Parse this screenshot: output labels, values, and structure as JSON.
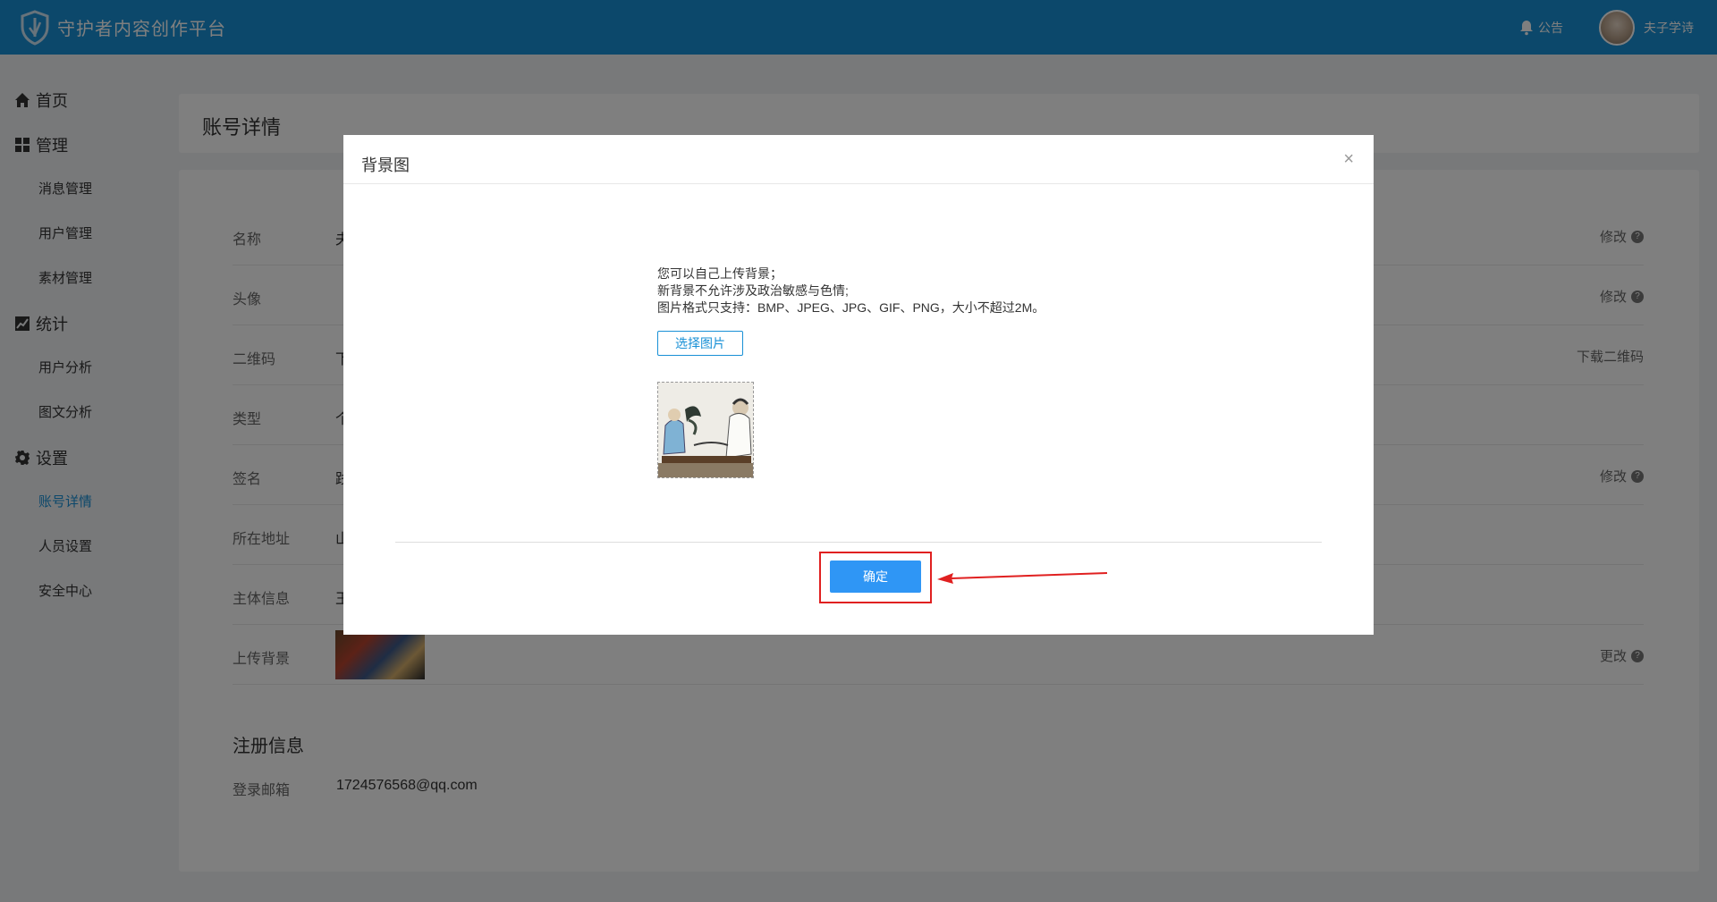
{
  "header": {
    "app_title": "守护者内容创作平台",
    "notice_label": "公告",
    "username": "夫子学诗",
    "brand_color": "#1890d6"
  },
  "sidebar": {
    "groups": [
      {
        "icon": "home-icon",
        "label": "首页"
      },
      {
        "icon": "grid-icon",
        "label": "管理"
      },
      {
        "icon": "chart-icon",
        "label": "统计"
      },
      {
        "icon": "gear-icon",
        "label": "设置"
      }
    ],
    "items": [
      "消息管理",
      "用户管理",
      "素材管理",
      "用户分析",
      "图文分析",
      "账号详情",
      "人员设置",
      "安全中心"
    ],
    "active_item": "账号详情"
  },
  "page": {
    "title": "账号详情"
  },
  "details": {
    "rows": [
      {
        "label": "名称",
        "value": "夫",
        "action": "修改"
      },
      {
        "label": "头像",
        "value": "",
        "action": "修改"
      },
      {
        "label": "二维码",
        "value": "下",
        "action": "下载二维码"
      },
      {
        "label": "类型",
        "value": "个",
        "action": ""
      },
      {
        "label": "签名",
        "value": "践",
        "action": "修改"
      },
      {
        "label": "所在地址",
        "value": "山",
        "action": ""
      },
      {
        "label": "主体信息",
        "value": "王",
        "action": ""
      },
      {
        "label": "上传背景",
        "value": "",
        "action": "更改"
      }
    ],
    "registration": {
      "title": "注册信息",
      "email_label": "登录邮箱",
      "email_value": "1724576568@qq.com"
    }
  },
  "modal": {
    "title": "背景图",
    "close_glyph": "×",
    "tips": [
      "您可以自己上传背景；",
      "新背景不允许涉及政治敏感与色情;",
      "图片格式只支持：BMP、JPEG、JPG、GIF、PNG，大小不超过2M。"
    ],
    "select_button": "选择图片",
    "ok_button": "确定",
    "highlight_color": "#e02020",
    "ok_button_color": "#2f96f5"
  }
}
